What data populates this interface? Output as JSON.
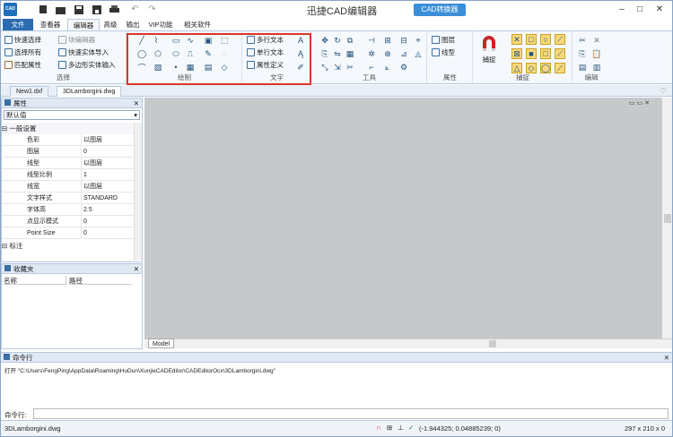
{
  "app": {
    "title": "迅捷CAD编辑器",
    "logo": "CAD",
    "convert_label": "CAD转换器"
  },
  "tabs": [
    "文件",
    "查看器",
    "编辑器",
    "高级",
    "输出",
    "VIP功能",
    "相关软件"
  ],
  "ribbon": {
    "select": {
      "label": "选择",
      "items": [
        "快速选择",
        "选择所有",
        "匹配属性"
      ]
    },
    "edit_ops": {
      "items": [
        "块编辑器",
        "快速实体导入",
        "多边形实体输入"
      ]
    },
    "draw": {
      "label": "绘制"
    },
    "text": {
      "label": "文字",
      "items": [
        "多行文本",
        "单行文本",
        "属性定义"
      ]
    },
    "tools": {
      "label": "工具"
    },
    "props": {
      "label": "属性",
      "items": [
        "图层",
        "线型"
      ]
    },
    "snap": {
      "label": "捕捉",
      "button": "捕捉"
    },
    "edit": {
      "label": "编辑"
    }
  },
  "doc_tabs": [
    "New1.dxf",
    "3DLamborgini.dwg"
  ],
  "properties": {
    "title": "属性",
    "dropdown": "默认值",
    "section1": "一般设置",
    "rows": [
      {
        "k": "色彩",
        "v": "以图层"
      },
      {
        "k": "图层",
        "v": "0"
      },
      {
        "k": "线型",
        "v": "以图层"
      },
      {
        "k": "线型比例",
        "v": "1"
      },
      {
        "k": "线宽",
        "v": "以图层"
      },
      {
        "k": "文字样式",
        "v": "STANDARD"
      },
      {
        "k": "字体高",
        "v": "2.5"
      },
      {
        "k": "点显示模式",
        "v": "0"
      },
      {
        "k": "Point Size",
        "v": "0"
      }
    ],
    "section2": "标注"
  },
  "favorites": {
    "title": "收藏夹",
    "col1": "名称",
    "col2": "路径"
  },
  "canvas": {
    "model_tab": "Model"
  },
  "command": {
    "title": "命令行",
    "log": "打开 \"C:\\Users\\FengPing\\AppData\\Roaming\\HuDun\\XunjieCADEditor\\CADEditorOcx\\3DLamborgini.dwg\"",
    "prompt": "命令行:"
  },
  "status": {
    "file": "3DLamborgini.dwg",
    "coords": "(-1.944325; 0.04885239; 0)",
    "size": "297 x 210 x 0"
  },
  "colors": {
    "accent": "#2b6cb0",
    "highlight": "#d9362b",
    "canvas": "#c6c9cc"
  }
}
